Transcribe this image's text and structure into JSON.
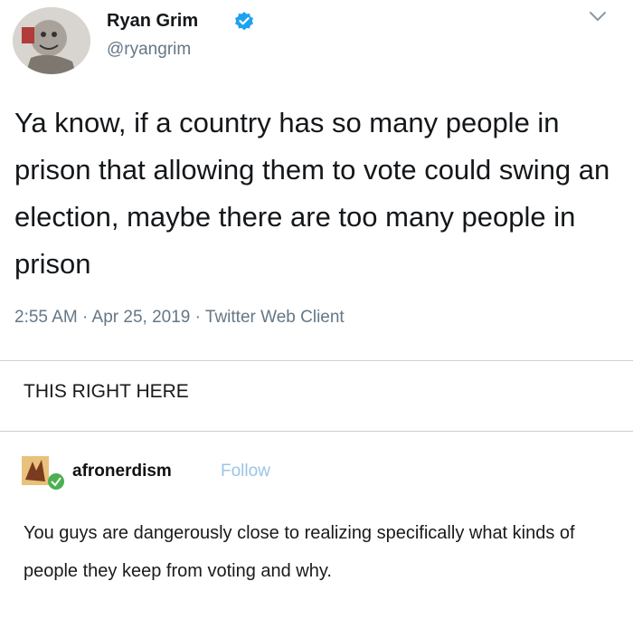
{
  "tweet": {
    "author_name": "Ryan Grim",
    "handle": "@ryangrim",
    "text": "Ya know, if a country has so many people in prison that allowing them to vote could swing an election, maybe there are too many people in prison",
    "meta": "2:55 AM · Apr 25, 2019 · Twitter Web Client",
    "verified_color": "#1da1f2",
    "icons": [
      "avatar",
      "verified-badge-icon",
      "chevron-down-icon"
    ]
  },
  "caption": "THIS RIGHT HERE",
  "reply": {
    "username": "afronerdism",
    "follow_label": "Follow",
    "text": "You guys are dangerously close to realizing specifically what kinds of people they keep from voting and why.",
    "follow_color": "#9cc4e4"
  }
}
